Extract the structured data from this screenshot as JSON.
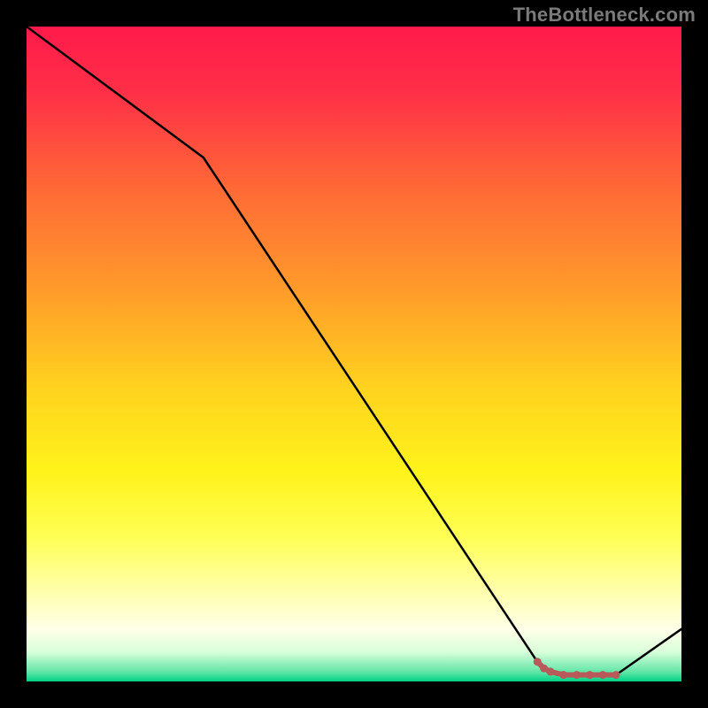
{
  "watermark": "TheBottleneck.com",
  "chart_data": {
    "type": "line",
    "title": "",
    "xlabel": "",
    "ylabel": "",
    "xlim": [
      0,
      100
    ],
    "ylim": [
      0,
      100
    ],
    "grid": false,
    "legend": false,
    "gradient_stops": [
      {
        "offset": 0,
        "color": "#ff1a4b"
      },
      {
        "offset": 0.1,
        "color": "#ff2f47"
      },
      {
        "offset": 0.25,
        "color": "#ff6a36"
      },
      {
        "offset": 0.4,
        "color": "#ff9a2a"
      },
      {
        "offset": 0.55,
        "color": "#ffd21f"
      },
      {
        "offset": 0.68,
        "color": "#fff31a"
      },
      {
        "offset": 0.78,
        "color": "#ffff55"
      },
      {
        "offset": 0.86,
        "color": "#ffffaa"
      },
      {
        "offset": 0.92,
        "color": "#ffffe8"
      },
      {
        "offset": 0.955,
        "color": "#d9ffd9"
      },
      {
        "offset": 0.985,
        "color": "#63e6a8"
      },
      {
        "offset": 1.0,
        "color": "#00d184"
      }
    ],
    "series": [
      {
        "name": "bottleneck-curve",
        "color": "#000000",
        "x": [
          0,
          27,
          78,
          81,
          90,
          100
        ],
        "values": [
          100,
          80,
          3,
          1,
          1,
          8
        ]
      },
      {
        "name": "optimal-marker",
        "color": "#b85a5a",
        "x": [
          78,
          79,
          80,
          82,
          84,
          86,
          88,
          90
        ],
        "values": [
          3,
          2,
          1.5,
          1,
          1,
          1,
          1,
          1
        ]
      }
    ]
  }
}
